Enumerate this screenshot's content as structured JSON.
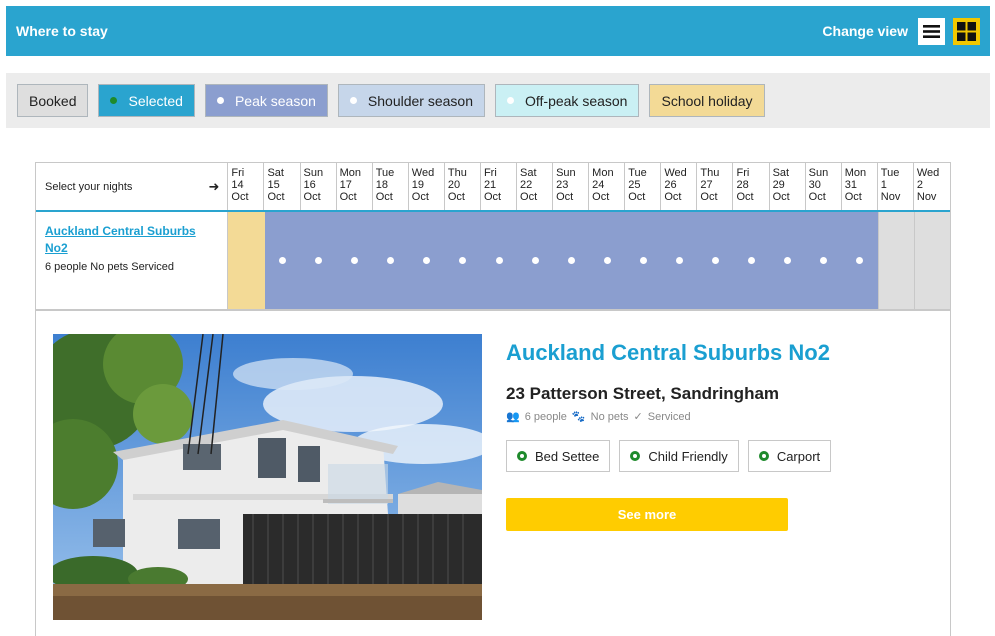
{
  "header": {
    "title": "Where to stay",
    "change_view": "Change view"
  },
  "legend": {
    "booked": "Booked",
    "selected": "Selected",
    "peak": "Peak season",
    "shoulder": "Shoulder season",
    "offpeak": "Off-peak season",
    "school": "School holiday"
  },
  "calendar": {
    "label": "Select your nights",
    "days": [
      {
        "dow": "Fri",
        "d": "14",
        "m": "Oct"
      },
      {
        "dow": "Sat",
        "d": "15",
        "m": "Oct"
      },
      {
        "dow": "Sun",
        "d": "16",
        "m": "Oct"
      },
      {
        "dow": "Mon",
        "d": "17",
        "m": "Oct"
      },
      {
        "dow": "Tue",
        "d": "18",
        "m": "Oct"
      },
      {
        "dow": "Wed",
        "d": "19",
        "m": "Oct"
      },
      {
        "dow": "Thu",
        "d": "20",
        "m": "Oct"
      },
      {
        "dow": "Fri",
        "d": "21",
        "m": "Oct"
      },
      {
        "dow": "Sat",
        "d": "22",
        "m": "Oct"
      },
      {
        "dow": "Sun",
        "d": "23",
        "m": "Oct"
      },
      {
        "dow": "Mon",
        "d": "24",
        "m": "Oct"
      },
      {
        "dow": "Tue",
        "d": "25",
        "m": "Oct"
      },
      {
        "dow": "Wed",
        "d": "26",
        "m": "Oct"
      },
      {
        "dow": "Thu",
        "d": "27",
        "m": "Oct"
      },
      {
        "dow": "Fri",
        "d": "28",
        "m": "Oct"
      },
      {
        "dow": "Sat",
        "d": "29",
        "m": "Oct"
      },
      {
        "dow": "Sun",
        "d": "30",
        "m": "Oct"
      },
      {
        "dow": "Mon",
        "d": "31",
        "m": "Oct"
      },
      {
        "dow": "Tue",
        "d": "1",
        "m": "Nov"
      },
      {
        "dow": "Wed",
        "d": "2",
        "m": "Nov"
      }
    ],
    "row": {
      "name": "Auckland Central Suburbs No2",
      "tags": "6 people No pets Serviced",
      "cells": [
        "school",
        "peak",
        "peak",
        "peak",
        "peak",
        "peak",
        "peak",
        "peak",
        "peak",
        "peak",
        "peak",
        "peak",
        "peak",
        "peak",
        "peak",
        "peak",
        "peak",
        "peak",
        "booked",
        "booked"
      ]
    }
  },
  "property": {
    "title": "Auckland Central Suburbs No2",
    "address": "23 Patterson Street, Sandringham",
    "people": "6 people",
    "pets": "No pets",
    "serviced": "Serviced",
    "features": [
      "Bed Settee",
      "Child Friendly",
      "Carport"
    ],
    "see_more": "See more"
  },
  "colors": {
    "brand": "#2aa4cf",
    "peak": "#8b9ecf",
    "school": "#f3da96",
    "booked": "#dedede",
    "button": "#ffcc00"
  }
}
